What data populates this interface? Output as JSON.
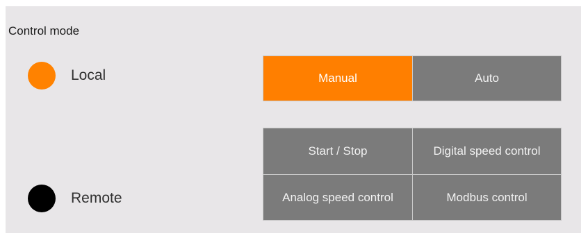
{
  "panel": {
    "title": "Control mode"
  },
  "indicators": {
    "local": {
      "label": "Local",
      "color": "#ff8200",
      "state": "active"
    },
    "remote": {
      "label": "Remote",
      "color": "#000000",
      "state": "inactive"
    }
  },
  "mode_buttons": {
    "manual": {
      "label": "Manual",
      "selected": true
    },
    "auto": {
      "label": "Auto",
      "selected": false
    }
  },
  "remote_buttons": {
    "start_stop": {
      "label": "Start / Stop"
    },
    "digital_speed": {
      "label": "Digital speed control"
    },
    "analog_speed": {
      "label": "Analog speed control"
    },
    "modbus": {
      "label": "Modbus control"
    }
  },
  "colors": {
    "accent": "#ff7f00",
    "button_gray": "#7b7b7b",
    "panel_bg": "#e8e6e8"
  }
}
